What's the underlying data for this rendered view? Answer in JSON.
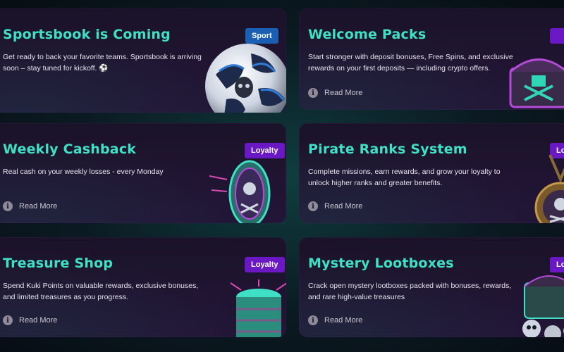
{
  "cards": [
    {
      "title": "Sportsbook is Coming",
      "description": "Get ready to back your favorite teams. Sportsbook is arriving soon – stay tuned for kickoff. ⚽",
      "badge": "Sport",
      "image": "soccer-ball-icon"
    },
    {
      "title": "Welcome Packs",
      "description": "Start stronger with deposit bonuses, Free Spins, and exclusive rewards on your first deposits — including crypto offers.",
      "read_more": "Read More",
      "image": "treasure-chest-icon"
    },
    {
      "title": "Weekly Cashback",
      "description": "Real cash on your weekly losses - every Monday",
      "badge": "Loyalty",
      "read_more": "Read More",
      "image": "pirate-coin-icon"
    },
    {
      "title": "Pirate Ranks System",
      "description": "Complete missions, earn rewards, and grow your loyalty to unlock higher ranks and greater benefits.",
      "badge": "Lo",
      "read_more": "Read More",
      "image": "skull-medal-icon"
    },
    {
      "title": "Treasure Shop",
      "description": "Spend Kuki Points on valuable rewards, exclusive bonuses, and limited treasures as you progress.",
      "badge": "Loyalty",
      "read_more": "Read More",
      "image": "coin-stack-icon"
    },
    {
      "title": "Mystery Lootboxes",
      "description": "Crack open mystery lootboxes packed with bonuses, rewards, and rare high-value treasures",
      "badge": "Lo",
      "read_more": "Read More",
      "image": "lootbox-skulls-icon"
    }
  ],
  "colors": {
    "title": "#3fe0c6",
    "sport_badge": "#1a5fb4",
    "loyalty_badge": "#6a18c4",
    "card_bg": "#1f1430"
  }
}
